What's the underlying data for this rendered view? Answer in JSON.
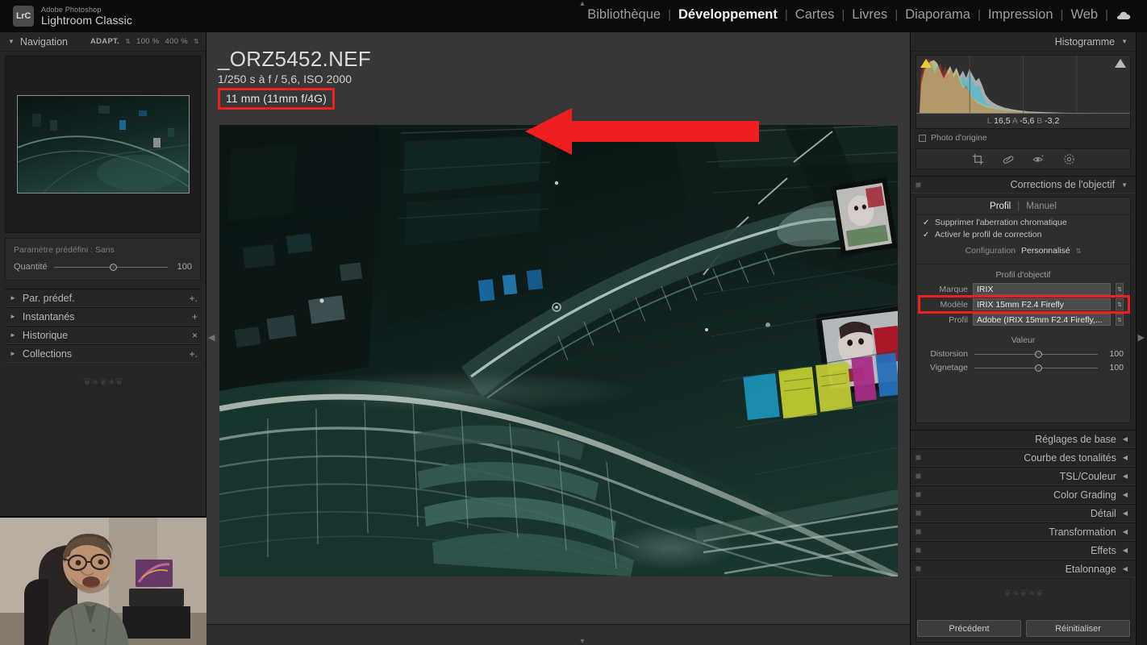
{
  "app": {
    "brand_line1": "Adobe Photoshop",
    "brand_line2": "Lightroom Classic",
    "logo_badge": "LrC"
  },
  "modules": [
    {
      "label": "Bibliothèque",
      "active": false
    },
    {
      "label": "Développement",
      "active": true
    },
    {
      "label": "Cartes",
      "active": false
    },
    {
      "label": "Livres",
      "active": false
    },
    {
      "label": "Diaporama",
      "active": false
    },
    {
      "label": "Impression",
      "active": false
    },
    {
      "label": "Web",
      "active": false
    }
  ],
  "left_panel": {
    "navigation": {
      "title": "Navigation",
      "zoom_options": [
        "ADAPT.",
        "100 %",
        "400 %"
      ]
    },
    "preset_preview": {
      "label": "Paramètre prédéfini : Sans",
      "amount_label": "Quantité",
      "amount_value": "100"
    },
    "sections": [
      {
        "label": "Par. prédef.",
        "action": "+."
      },
      {
        "label": "Instantanés",
        "action": "+"
      },
      {
        "label": "Historique",
        "action": "×"
      },
      {
        "label": "Collections",
        "action": "+."
      }
    ]
  },
  "photo_info": {
    "filename": "_ORZ5452.NEF",
    "exposure": "1/250 s à f / 5,6, ISO 2000",
    "lens": "11 mm (11mm f/4G)",
    "highlight_color": "#f01e1e"
  },
  "right_panel": {
    "histogram": {
      "title": "Histogramme",
      "readout": {
        "l_label": "L",
        "l_value": "16,5",
        "a_label": "A",
        "a_value": "-5,6",
        "b_label": "B",
        "b_value": "-3,2"
      },
      "original_photo_label": "Photo d'origine"
    },
    "tools": [
      "crop-icon",
      "spot-removal-icon",
      "red-eye-icon",
      "masking-icon"
    ],
    "lens_corrections": {
      "title": "Corrections de l'objectif",
      "tabs": [
        {
          "label": "Profil",
          "active": true
        },
        {
          "label": "Manuel",
          "active": false
        }
      ],
      "checkboxes": [
        {
          "label": "Supprimer l'aberration chromatique",
          "checked": true
        },
        {
          "label": "Activer le profil de correction",
          "checked": true
        }
      ],
      "configuration": {
        "label": "Configuration",
        "value": "Personnalisé"
      },
      "profile_section_title": "Profil d'objectif",
      "profile_fields": [
        {
          "label": "Marque",
          "value": "IRIX",
          "highlighted": false
        },
        {
          "label": "Modèle",
          "value": "IRIX 15mm F2.4 Firefly",
          "highlighted": true
        },
        {
          "label": "Profil",
          "value": "Adobe (IRIX 15mm F2.4 Firefly,...",
          "highlighted": false
        }
      ],
      "value_section_title": "Valeur",
      "sliders": [
        {
          "label": "Distorsion",
          "value": "100"
        },
        {
          "label": "Vignetage",
          "value": "100"
        }
      ]
    },
    "collapsed_sections": [
      {
        "label": "Réglages de base",
        "has_switch": false
      },
      {
        "label": "Courbe des tonalités",
        "has_switch": true
      },
      {
        "label": "TSL/Couleur",
        "has_switch": true
      },
      {
        "label": "Color Grading",
        "has_switch": true
      },
      {
        "label": "Détail",
        "has_switch": true
      },
      {
        "label": "Transformation",
        "has_switch": true
      },
      {
        "label": "Effets",
        "has_switch": true
      },
      {
        "label": "Etalonnage",
        "has_switch": true
      }
    ],
    "buttons": [
      {
        "label": "Précédent"
      },
      {
        "label": "Réinitialiser"
      }
    ]
  }
}
